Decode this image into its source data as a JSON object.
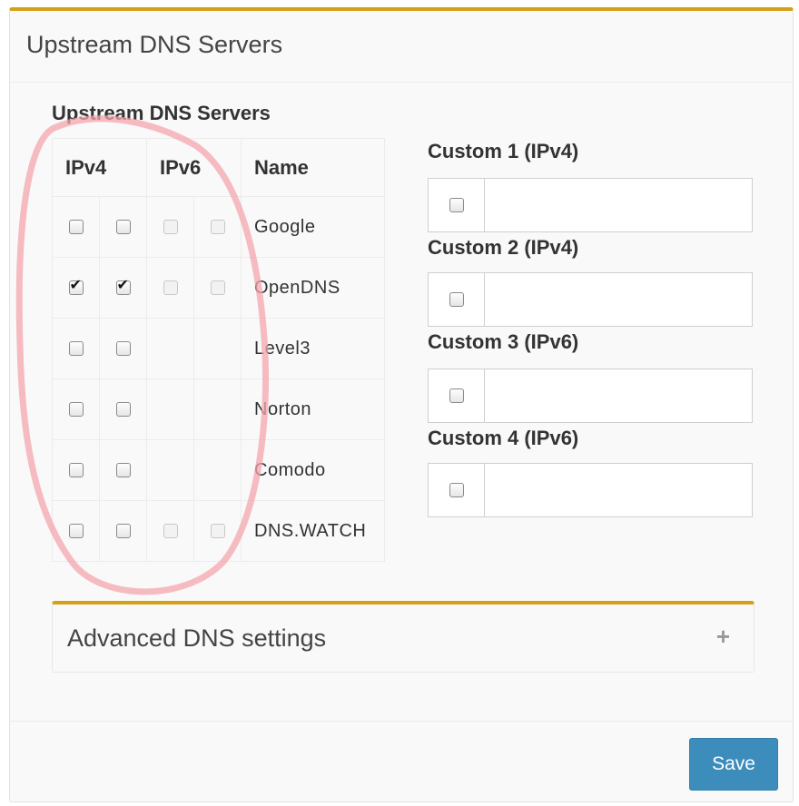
{
  "panel": {
    "title": "Upstream DNS Servers",
    "section_title": "Upstream DNS Servers"
  },
  "table": {
    "headers": {
      "ipv4": "IPv4",
      "ipv6": "IPv6",
      "name": "Name"
    },
    "rows": [
      {
        "name": "Google",
        "ipv4": [
          false,
          false
        ],
        "ipv6": [
          false,
          false
        ],
        "ipv6_available": true
      },
      {
        "name": "OpenDNS",
        "ipv4": [
          true,
          true
        ],
        "ipv6": [
          false,
          false
        ],
        "ipv6_available": true
      },
      {
        "name": "Level3",
        "ipv4": [
          false,
          false
        ],
        "ipv6": [],
        "ipv6_available": false
      },
      {
        "name": "Norton",
        "ipv4": [
          false,
          false
        ],
        "ipv6": [],
        "ipv6_available": false
      },
      {
        "name": "Comodo",
        "ipv4": [
          false,
          false
        ],
        "ipv6": [],
        "ipv6_available": false
      },
      {
        "name": "DNS.WATCH",
        "ipv4": [
          false,
          false
        ],
        "ipv6": [
          false,
          false
        ],
        "ipv6_available": true
      }
    ]
  },
  "custom": [
    {
      "label": "Custom 1 (IPv4)",
      "checked": false,
      "value": ""
    },
    {
      "label": "Custom 2 (IPv4)",
      "checked": false,
      "value": ""
    },
    {
      "label": "Custom 3 (IPv6)",
      "checked": false,
      "value": ""
    },
    {
      "label": "Custom 4 (IPv6)",
      "checked": false,
      "value": ""
    }
  ],
  "advanced": {
    "title": "Advanced DNS settings",
    "expand_icon": "plus-icon"
  },
  "footer": {
    "save_label": "Save"
  },
  "colors": {
    "accent_border": "#d4a017",
    "save_button": "#3c8dbc",
    "annotation_stroke": "#f3a6ad"
  }
}
